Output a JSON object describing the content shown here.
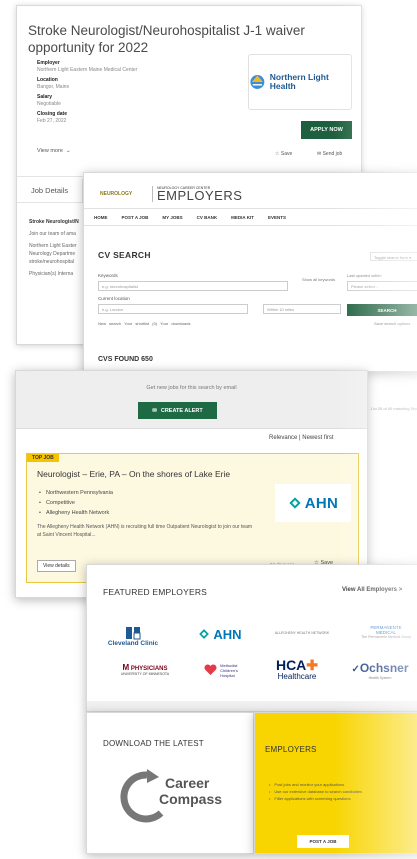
{
  "job": {
    "title": "Stroke Neurologist/Neurohospitalist J-1 waiver opportunity for 2022",
    "employer_label": "Employer",
    "employer": "Northern Light Eastern Maine Medical Center",
    "location_label": "Location",
    "location": "Bangor, Maine",
    "salary_label": "Salary",
    "salary": "Negotiable",
    "closing_label": "Closing date",
    "closing": "Feb 27, 2022",
    "view_more": "View more",
    "logo_name": "Northern Light Health",
    "apply_label": "APPLY NOW",
    "save_label": "Save",
    "send_label": "Send job",
    "tab_details": "Job Details",
    "body_heading": "Stroke Neurologist/N",
    "body_line1": "Join our team of ama",
    "body_line2": "Northern Light Easter",
    "body_line3": "Neurology Departme",
    "body_line4": "stroke/neurohospital",
    "body_line5": "Physician(s) Interna"
  },
  "cv": {
    "logo_small": "NEUROLOGY",
    "brand_sub": "NEUROLOGY CAREER CENTER",
    "brand_main": "EMPLOYERS",
    "nav": [
      "HOME",
      "POST A JOB",
      "MY JOBS",
      "CV BANK",
      "MEDIA KIT",
      "EVENTS"
    ],
    "title": "CV SEARCH",
    "toggle": "Toggle search form ▾",
    "keywords_label": "Keywords",
    "keywords_placeholder": "e.g. neurohospitalist",
    "location_label": "Current location",
    "location_placeholder": "e.g. London",
    "radius_placeholder": "Within 10 miles",
    "show_all": "Show all keywords",
    "last_updated_label": "Last updated within",
    "please_select": "Please select...",
    "search_btn": "SEARCH",
    "small_links": "New search   Your shortlist (0)   Your downloads",
    "save_search": "Save search options",
    "cvs_found": "CVS FOUND 650"
  },
  "alert": {
    "message": "Get new jobs for this search by email",
    "button": "CREATE ALERT",
    "sort": "Relevance  |  Newest first",
    "matching": "1 to 20 of 40 matching Sto",
    "badge": "TOP JOB",
    "tj_title": "Neurologist – Erie, PA – On the shores of Lake Erie",
    "bullets": [
      "Northwestern Pennsylvania",
      "Competitive",
      "Allegheny Health Network"
    ],
    "desc": "The Allegheny Health Network (AHN) is recruiting full time Outpatient Neurologist to join our team at Saint Vincent Hospital...",
    "logo_name": "AHN",
    "view_details": "View details",
    "days_ago": "24 days ago",
    "save": "Save"
  },
  "employers": {
    "title": "FEATURED EMPLOYERS",
    "view_all": "View All Employers >",
    "cleveland": "Cleveland Clinic",
    "ahn": "AHN",
    "ahn_small": "ALLEGHENY HEALTH NETWORK",
    "permanente_1": "PERMANENTE",
    "permanente_2": "MEDICAL",
    "permanente_3": "The Permanente Medical Group",
    "mphys_top": "PHYSICIANS",
    "mphys_sub": "UNIVERSITY OF MINNESOTA",
    "mch_1": "Methodist",
    "mch_2": "Children's",
    "mch_3": "Hospital",
    "hca_top": "HCA",
    "hca_sub": "Healthcare",
    "och_top": "Ochsner",
    "och_sub": "Health System"
  },
  "download": {
    "title": "DOWNLOAD THE LATEST",
    "brand1": "Career",
    "brand2": "Compass"
  },
  "employers_box": {
    "title": "EMPLOYERS",
    "items": [
      "Post jobs and monitor your applications",
      "Use our extensive database to search candidates",
      "Filter applications with screening questions"
    ],
    "post_btn": "POST A JOB"
  },
  "colors": {
    "brand_green": "#1d5f3e",
    "top_job_yellow": "#f4c400",
    "employers_yellow": "#f8d500",
    "ahn_blue": "#0077b6"
  }
}
